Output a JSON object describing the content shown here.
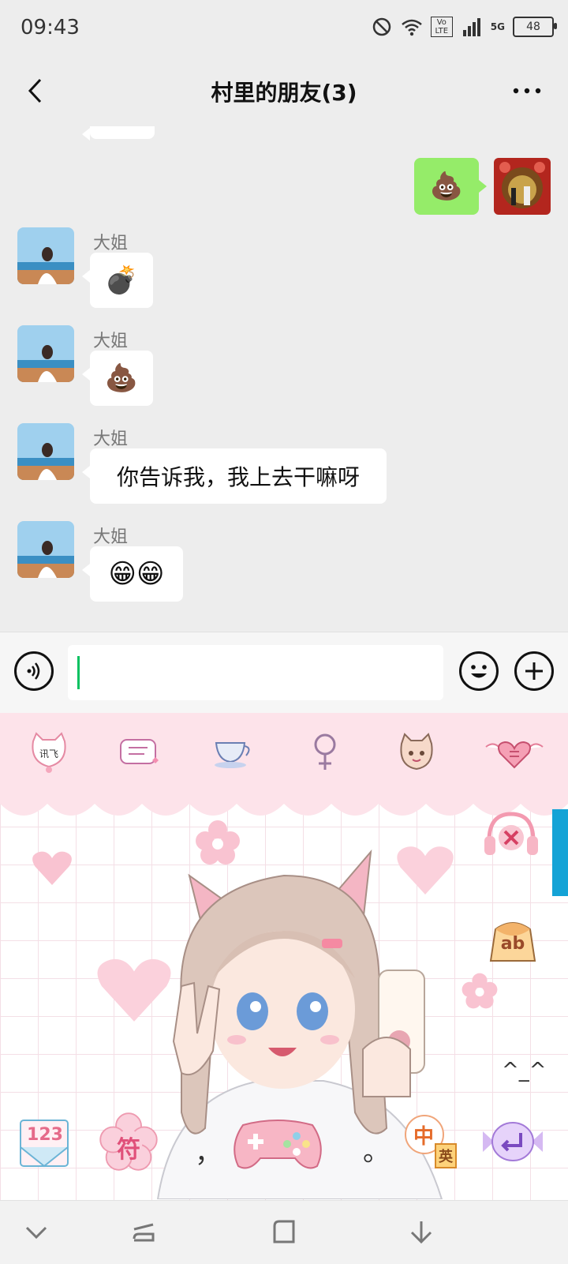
{
  "status_bar": {
    "time": "09:43",
    "battery": "48",
    "network": "5G",
    "volte": "Vo LTE"
  },
  "header": {
    "title": "村里的朋友(3)",
    "back_icon": "chevron-left-icon",
    "more_icon": "more-dots-icon"
  },
  "messages": [
    {
      "from": "me",
      "content": "💩"
    },
    {
      "from": "大姐",
      "sender": "大姐",
      "content": "💣"
    },
    {
      "from": "大姐",
      "sender": "大姐",
      "content": "💩"
    },
    {
      "from": "大姐",
      "sender": "大姐",
      "content": "你告诉我，我上去干嘛呀"
    },
    {
      "from": "大姐",
      "sender": "大姐",
      "content": "😁😁"
    }
  ],
  "input_bar": {
    "voice_icon": "voice-icon",
    "emoji_icon": "emoji-face-icon",
    "plus_icon": "plus-icon",
    "text": ""
  },
  "keyboard": {
    "brand_icon_label": "讯飞",
    "key_123": "123",
    "key_symbols": "符",
    "key_zh": "中",
    "key_en": "英",
    "key_ab": "ab",
    "kaomoji": "^_^",
    "comma": "，",
    "period": "。",
    "colors": {
      "pink_bg": "#fde3ea",
      "accent_blue": "#14a3d6"
    }
  },
  "nav_bar": {
    "icons": [
      "chevron-down-icon",
      "recent-apps-icon",
      "home-square-icon",
      "download-arrow-icon"
    ]
  }
}
